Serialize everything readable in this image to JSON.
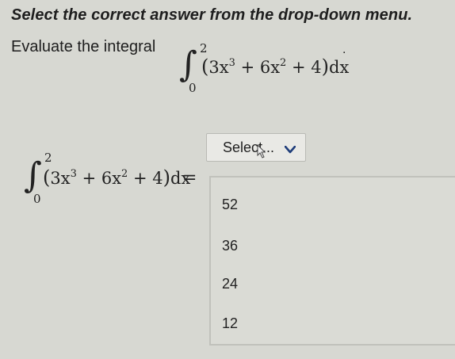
{
  "instruction": "Select the correct answer from the drop-down menu.",
  "question": {
    "prompt": "Evaluate the integral",
    "integral": {
      "upper_limit": "2",
      "lower_limit": "0",
      "integrand_parts": {
        "coef1": "3",
        "var1": "x",
        "exp1": "3",
        "plus1": "+ 6",
        "var2": "x",
        "exp2": "2",
        "plus2": "+ 4",
        "dx": "dx"
      },
      "trailing_mark": "."
    }
  },
  "answer": {
    "equals": "=",
    "dropdown": {
      "selected": "Select...",
      "options": [
        "52",
        "36",
        "24",
        "12"
      ]
    }
  },
  "icons": {
    "chevron": "chevron-down-icon",
    "cursor": "mouse-cursor-icon"
  }
}
